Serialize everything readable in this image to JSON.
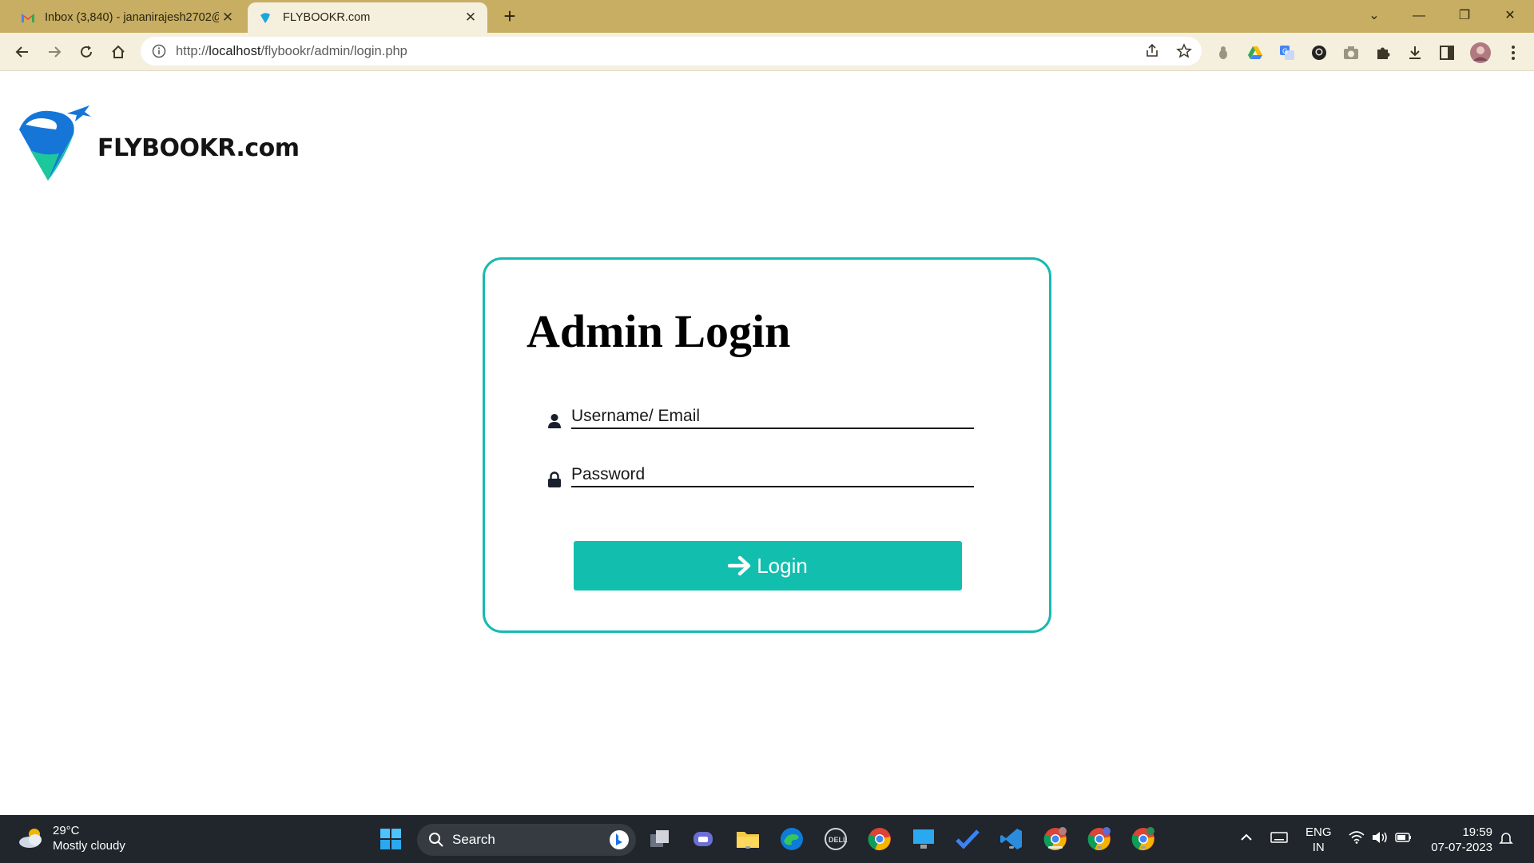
{
  "browser": {
    "tabs": [
      {
        "title": "Inbox (3,840) - jananirajesh2702@",
        "favicon": "gmail-icon",
        "active": false
      },
      {
        "title": "FLYBOOKR.com",
        "favicon": "flybookr-icon",
        "active": true
      }
    ],
    "url_prefix": "http://",
    "url_host": "localhost",
    "url_path": "/flybookr/admin/login.php"
  },
  "page": {
    "logo_text": "FLYBOOKR.com",
    "login_card": {
      "title": "Admin Login",
      "username_placeholder": "Username/ Email",
      "password_placeholder": "Password",
      "login_button": "Login"
    }
  },
  "taskbar": {
    "weather_temp": "29°C",
    "weather_desc": "Mostly cloudy",
    "search_label": "Search",
    "language_top": "ENG",
    "language_bottom": "IN",
    "time": "19:59",
    "date": "07-07-2023"
  },
  "colors": {
    "accent": "#12bfaf",
    "tabbar": "#c7ae62",
    "toolbar": "#f5efde",
    "taskbar": "#20262b"
  }
}
